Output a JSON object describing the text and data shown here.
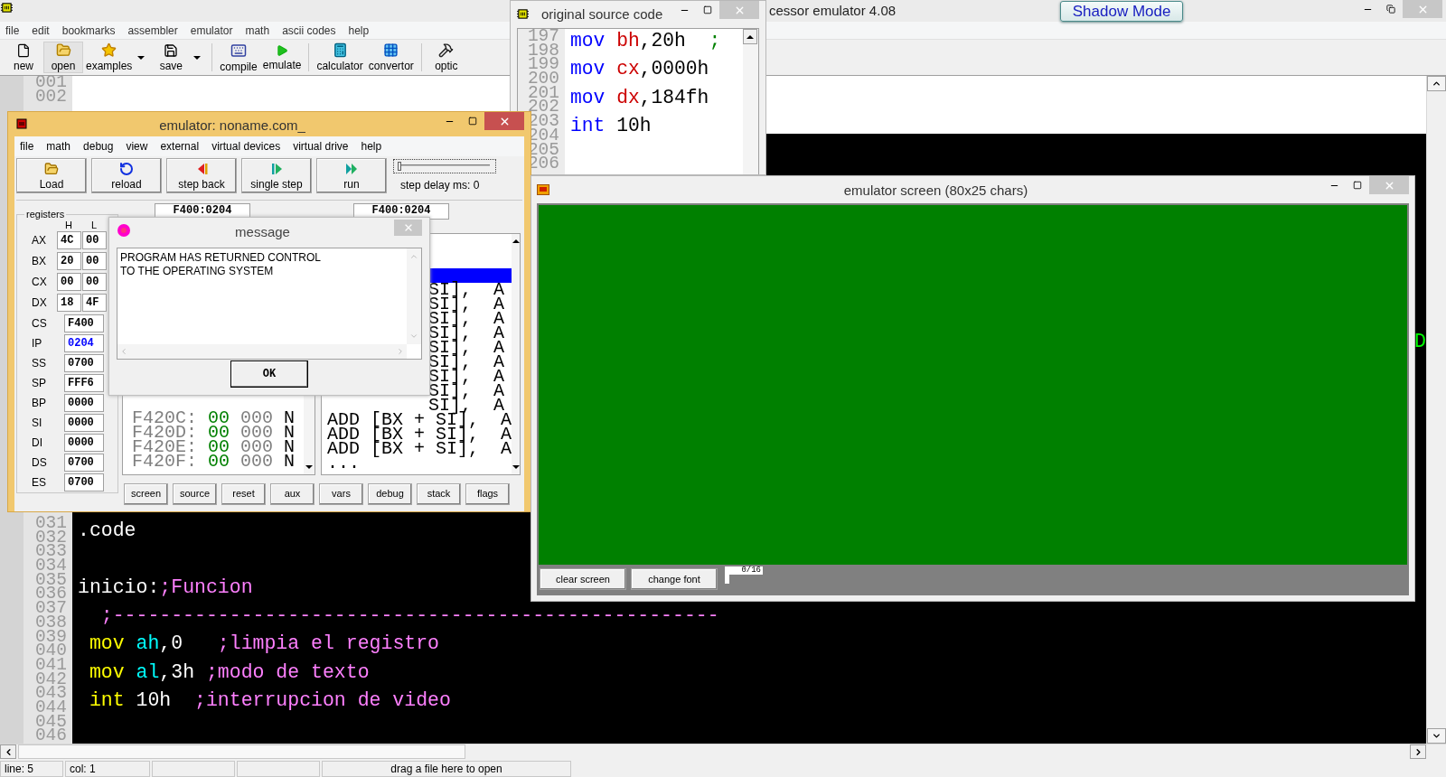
{
  "main_window": {
    "title": "cessor emulator 4.08",
    "overlay_button": "Shadow Mode",
    "menu": [
      "file",
      "edit",
      "bookmarks",
      "assembler",
      "emulator",
      "math",
      "ascii codes",
      "help"
    ],
    "toolbar": [
      [
        {
          "label": "new",
          "kind": "button"
        },
        {
          "label": "open",
          "kind": "button"
        },
        {
          "label": "examples",
          "kind": "dropdown"
        },
        {
          "label": "save",
          "kind": "dropdown"
        }
      ],
      [
        {
          "label": "compile",
          "kind": "button"
        },
        {
          "label": "emulate",
          "kind": "button"
        }
      ],
      [
        {
          "label": "calculator",
          "kind": "button"
        },
        {
          "label": "convertor",
          "kind": "button"
        }
      ],
      [
        {
          "label": "optic",
          "kind": "button"
        }
      ]
    ],
    "editor": {
      "top_line_numbers": [
        "001",
        "002"
      ],
      "line_numbers": [
        "031",
        "032",
        "033",
        "034",
        "035",
        "036",
        "037",
        "038",
        "039",
        "040",
        "041",
        "042",
        "043",
        "044",
        "045",
        "046"
      ],
      "lines": [
        {
          "kind": "code",
          "tokens": [
            {
              "text": ".code",
              "kind": "plain"
            }
          ]
        },
        {
          "kind": "blank"
        },
        {
          "kind": "code",
          "tokens": [
            {
              "text": "inicio:",
              "kind": "plain"
            },
            {
              "text": ";Funcion",
              "kind": "comment"
            }
          ]
        },
        {
          "kind": "code",
          "tokens": [
            {
              "text": "  ;----------------------------------------------------",
              "kind": "comment"
            }
          ]
        },
        {
          "kind": "code",
          "tokens": [
            {
              "text": " mov ",
              "kind": "keyword"
            },
            {
              "text": "ah",
              "kind": "register"
            },
            {
              "text": ",0   ",
              "kind": "plain"
            },
            {
              "text": ";limpia el registro",
              "kind": "comment"
            }
          ]
        },
        {
          "kind": "code",
          "tokens": [
            {
              "text": " mov ",
              "kind": "keyword"
            },
            {
              "text": "al",
              "kind": "register"
            },
            {
              "text": ",3h ",
              "kind": "plain"
            },
            {
              "text": ";modo de texto",
              "kind": "comment"
            }
          ]
        },
        {
          "kind": "code",
          "tokens": [
            {
              "text": " int ",
              "kind": "keyword"
            },
            {
              "text": "10h  ",
              "kind": "plain"
            },
            {
              "text": ";interrupcion de video",
              "kind": "comment"
            }
          ]
        },
        {
          "kind": "blank"
        }
      ],
      "edge_text": "D"
    },
    "status_bar": {
      "line": "line: 5",
      "col": "col: 1",
      "hint": "drag a file here to open"
    }
  },
  "source_window": {
    "title": "original source code",
    "line_numbers": [
      "197",
      "198",
      "199",
      "200",
      "201",
      "202",
      "203",
      "204",
      "205",
      "206"
    ],
    "lines": [
      {
        "kind": "code",
        "tokens": [
          {
            "text": "mov ",
            "kind": "keyword"
          },
          {
            "text": "bh",
            "kind": "register"
          },
          {
            "text": ",20h  ",
            "kind": "plain"
          },
          {
            "text": ";",
            "kind": "comment"
          }
        ]
      },
      {
        "kind": "code",
        "tokens": [
          {
            "text": "mov ",
            "kind": "keyword"
          },
          {
            "text": "cx",
            "kind": "register"
          },
          {
            "text": ",0000h",
            "kind": "plain"
          }
        ]
      },
      {
        "kind": "code",
        "tokens": [
          {
            "text": "mov ",
            "kind": "keyword"
          },
          {
            "text": "dx",
            "kind": "register"
          },
          {
            "text": ",184fh",
            "kind": "plain"
          }
        ]
      },
      {
        "kind": "code",
        "tokens": [
          {
            "text": "int ",
            "kind": "keyword"
          },
          {
            "text": "10h",
            "kind": "plain"
          }
        ]
      }
    ]
  },
  "emulator_window": {
    "title": "emulator: noname.com_",
    "menu": [
      "file",
      "math",
      "debug",
      "view",
      "external",
      "virtual devices",
      "virtual drive",
      "help"
    ],
    "toolbar": [
      "Load",
      "reload",
      "step back",
      "single step",
      "run"
    ],
    "step_delay": {
      "label": "step delay ms: 0",
      "level": 0
    },
    "registers": {
      "title": "registers",
      "columns": [
        "H",
        "L"
      ],
      "pairs": [
        {
          "name": "AX",
          "high": "4C",
          "low": "00"
        },
        {
          "name": "BX",
          "high": "20",
          "low": "00"
        },
        {
          "name": "CX",
          "high": "00",
          "low": "00"
        },
        {
          "name": "DX",
          "high": "18",
          "low": "4F"
        }
      ],
      "segments": [
        {
          "name": "CS",
          "value": "F400",
          "changed": false
        },
        {
          "name": "IP",
          "value": "0204",
          "changed": true
        },
        {
          "name": "SS",
          "value": "0700",
          "changed": false
        },
        {
          "name": "SP",
          "value": "FFF6",
          "changed": false
        },
        {
          "name": "BP",
          "value": "0000",
          "changed": false
        },
        {
          "name": "SI",
          "value": "0000",
          "changed": false
        },
        {
          "name": "DI",
          "value": "0000",
          "changed": false
        },
        {
          "name": "DS",
          "value": "0700",
          "changed": false
        },
        {
          "name": "ES",
          "value": "0700",
          "changed": false
        }
      ]
    },
    "memory_address": "F400:0204",
    "code_address": "F400:0204",
    "memory_rows": [
      {
        "address": "F420C:",
        "hex": "00",
        "decimal": "000",
        "char": "N"
      },
      {
        "address": "F420D:",
        "hex": "00",
        "decimal": "000",
        "char": "N"
      },
      {
        "address": "F420E:",
        "hex": "00",
        "decimal": "000",
        "char": "N"
      },
      {
        "address": "F420F:",
        "hex": "00",
        "decimal": "000",
        "char": "N"
      }
    ],
    "code_rows": [
      {
        "kind": "covered",
        "selected": true
      },
      {
        "kind": "partial",
        "text": "SI],  A",
        "selected": false
      },
      {
        "kind": "partial",
        "text": "SI],  A",
        "selected": false
      },
      {
        "kind": "partial",
        "text": "SI],  A",
        "selected": false
      },
      {
        "kind": "partial",
        "text": "SI],  A",
        "selected": false
      },
      {
        "kind": "partial",
        "text": "SI],  A",
        "selected": false
      },
      {
        "kind": "partial",
        "text": "SI],  A",
        "selected": false
      },
      {
        "kind": "partial",
        "text": "SI],  A",
        "selected": false
      },
      {
        "kind": "partial",
        "text": "SI],  A",
        "selected": false
      },
      {
        "kind": "partial",
        "text": "SI],  A",
        "selected": false
      },
      {
        "kind": "full",
        "text": "ADD [BX + SI],  A",
        "selected": false
      },
      {
        "kind": "full",
        "text": "ADD [BX + SI],  A",
        "selected": false
      },
      {
        "kind": "full",
        "text": "ADD [BX + SI],  A",
        "selected": false
      },
      {
        "kind": "full",
        "text": "...",
        "selected": false
      }
    ],
    "buttons": [
      "screen",
      "source",
      "reset",
      "aux",
      "vars",
      "debug",
      "stack",
      "flags"
    ]
  },
  "message_dialog": {
    "title": "message",
    "lines": [
      "PROGRAM HAS RETURNED CONTROL",
      "TO THE OPERATING SYSTEM"
    ],
    "button": "OK"
  },
  "screen_window": {
    "title": "emulator screen (80x25 chars)",
    "buttons": [
      "clear screen",
      "change font"
    ],
    "page": "0/16"
  }
}
